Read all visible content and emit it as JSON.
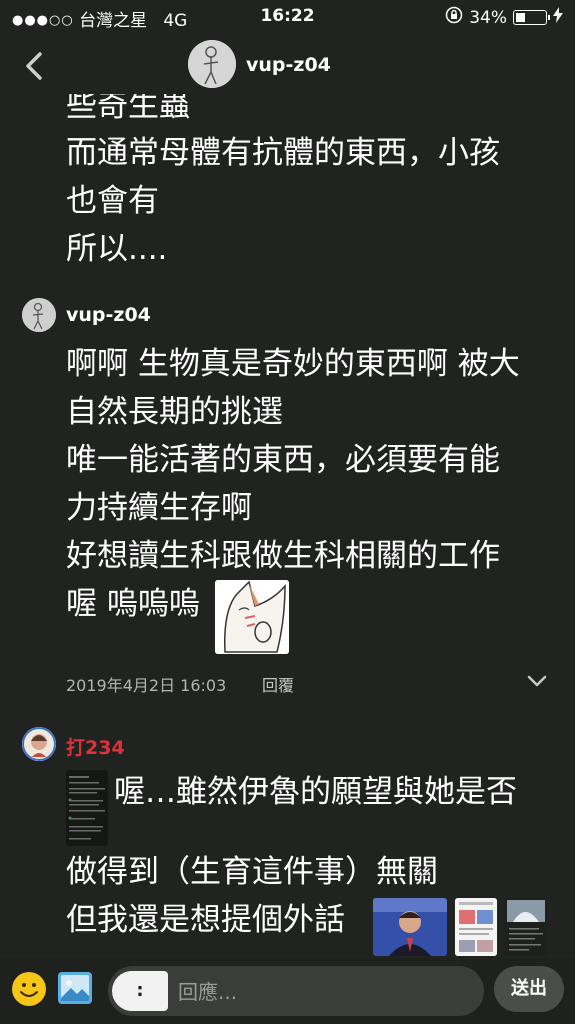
{
  "status_bar": {
    "signal": "●●●○○",
    "carrier": "台灣之星",
    "network": "4G",
    "time": "16:22",
    "battery_percent": "34%",
    "battery_level": 0.34
  },
  "nav": {
    "title": "vup-z04"
  },
  "messages": [
    {
      "lines": [
        "些奇生蟲",
        "而通常母體有抗體的東西，小孩",
        "也會有",
        "所以...."
      ]
    },
    {
      "author": "vup-z04",
      "lines": [
        "啊啊 生物真是奇妙的東西啊 被大",
        "自然長期的挑選",
        "唯一能活著的東西，必須要有能",
        "力持續生存啊",
        "好想讀生科跟做生科相關的工作",
        "喔 嗚嗚嗚"
      ],
      "date": "2019年4月2日 16:03",
      "reply_label": "回覆"
    },
    {
      "author": "打234",
      "author_color": "#e0303a",
      "lines": [
        "喔…雖然伊魯的願望與她是否",
        "做得到（生育這件事）無關",
        "但我還是想提個外話"
      ]
    }
  ],
  "composer": {
    "keyboard_toggle": ":",
    "placeholder": "回應...",
    "send_label": "送出"
  },
  "colors": {
    "background": "#202320",
    "secondary_text": "#b4b4b4",
    "accent_red": "#e0303a"
  }
}
